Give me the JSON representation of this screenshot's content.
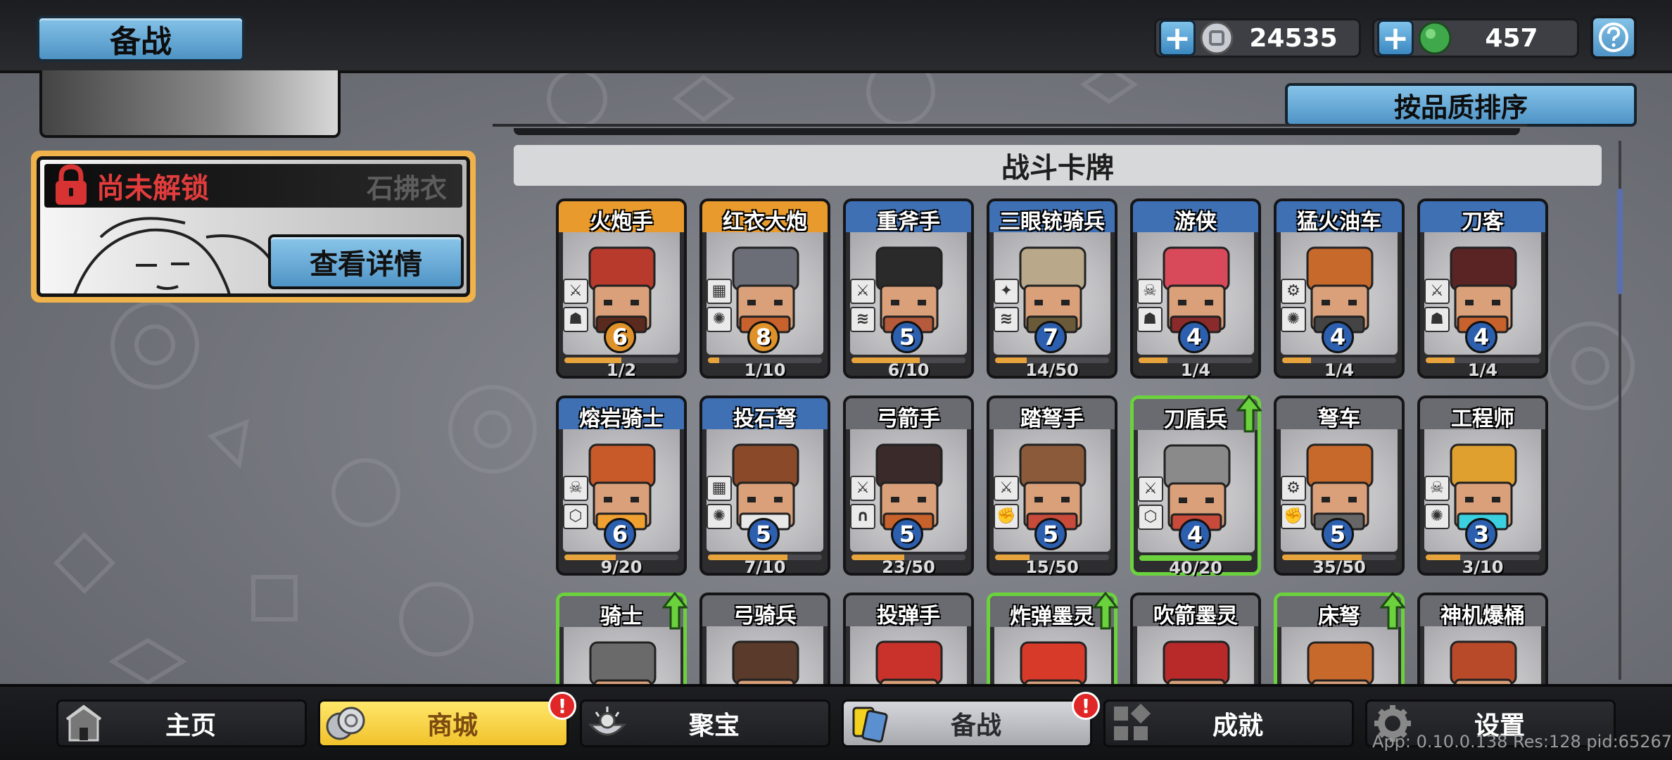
{
  "header": {
    "title": "备战",
    "silver": {
      "value": "24535",
      "add_label": "+"
    },
    "gems": {
      "value": "457",
      "add_label": "+"
    }
  },
  "left_panel": {
    "lock_label": "尚未解锁",
    "skin_name": "石拂衣",
    "detail_button": "查看详情"
  },
  "sort_button": "按品质排序",
  "section_title": "战斗卡牌",
  "cards": [
    {
      "name": "火炮手",
      "cost": "6",
      "count": "1/2",
      "progress": 0.5,
      "tier": "orange",
      "upgrade": false
    },
    {
      "name": "红衣大炮",
      "cost": "8",
      "count": "1/10",
      "progress": 0.1,
      "tier": "orange",
      "upgrade": false
    },
    {
      "name": "重斧手",
      "cost": "5",
      "count": "6/10",
      "progress": 0.6,
      "tier": "blue",
      "upgrade": false
    },
    {
      "name": "三眼铳骑兵",
      "cost": "7",
      "count": "14/50",
      "progress": 0.28,
      "tier": "blue",
      "upgrade": false
    },
    {
      "name": "游侠",
      "cost": "4",
      "count": "1/4",
      "progress": 0.25,
      "tier": "blue",
      "upgrade": false
    },
    {
      "name": "猛火油车",
      "cost": "4",
      "count": "1/4",
      "progress": 0.25,
      "tier": "blue",
      "upgrade": false
    },
    {
      "name": "刀客",
      "cost": "4",
      "count": "1/4",
      "progress": 0.25,
      "tier": "blue",
      "upgrade": false
    },
    {
      "name": "熔岩骑士",
      "cost": "6",
      "count": "9/20",
      "progress": 0.45,
      "tier": "blue",
      "upgrade": false
    },
    {
      "name": "投石弩",
      "cost": "5",
      "count": "7/10",
      "progress": 0.7,
      "tier": "blue",
      "upgrade": false
    },
    {
      "name": "弓箭手",
      "cost": "5",
      "count": "23/50",
      "progress": 0.46,
      "tier": "gray",
      "upgrade": false
    },
    {
      "name": "踏弩手",
      "cost": "5",
      "count": "15/50",
      "progress": 0.3,
      "tier": "gray",
      "upgrade": false
    },
    {
      "name": "刀盾兵",
      "cost": "4",
      "count": "40/20",
      "progress": 1.0,
      "tier": "gray",
      "upgrade": true
    },
    {
      "name": "弩车",
      "cost": "5",
      "count": "35/50",
      "progress": 0.7,
      "tier": "gray",
      "upgrade": false
    },
    {
      "name": "工程师",
      "cost": "3",
      "count": "3/10",
      "progress": 0.3,
      "tier": "gray",
      "upgrade": false
    },
    {
      "name": "骑士",
      "cost": "",
      "count": "",
      "progress": 0,
      "tier": "gray",
      "upgrade": true
    },
    {
      "name": "弓骑兵",
      "cost": "",
      "count": "",
      "progress": 0,
      "tier": "gray",
      "upgrade": false
    },
    {
      "name": "投弹手",
      "cost": "",
      "count": "",
      "progress": 0,
      "tier": "gray",
      "upgrade": false
    },
    {
      "name": "炸弹墨灵",
      "cost": "",
      "count": "",
      "progress": 0,
      "tier": "gray",
      "upgrade": true
    },
    {
      "name": "吹箭墨灵",
      "cost": "",
      "count": "",
      "progress": 0,
      "tier": "gray",
      "upgrade": false
    },
    {
      "name": "床弩",
      "cost": "",
      "count": "",
      "progress": 0,
      "tier": "gray",
      "upgrade": true
    },
    {
      "name": "神机爆桶",
      "cost": "",
      "count": "",
      "progress": 0,
      "tier": "gray",
      "upgrade": false
    }
  ],
  "nav": [
    {
      "label": "主页",
      "icon": "castle-icon",
      "badge": ""
    },
    {
      "label": "商城",
      "icon": "coins-icon",
      "badge": "!"
    },
    {
      "label": "聚宝",
      "icon": "treasure-bowl-icon",
      "badge": ""
    },
    {
      "label": "备战",
      "icon": "cards-icon",
      "badge": "!"
    },
    {
      "label": "成就",
      "icon": "achievement-grid-icon",
      "badge": ""
    },
    {
      "label": "设置",
      "icon": "gear-icon",
      "badge": ""
    }
  ],
  "build_info": "App: 0.10.0.138 Res:128 pid:65267",
  "colors": {
    "accent_blue": "#4f94c6",
    "tier_orange": "#e89a2c",
    "tier_blue": "#3f70b4",
    "upgrade_green": "#6bd23e",
    "locked_red": "#e23c3c"
  }
}
